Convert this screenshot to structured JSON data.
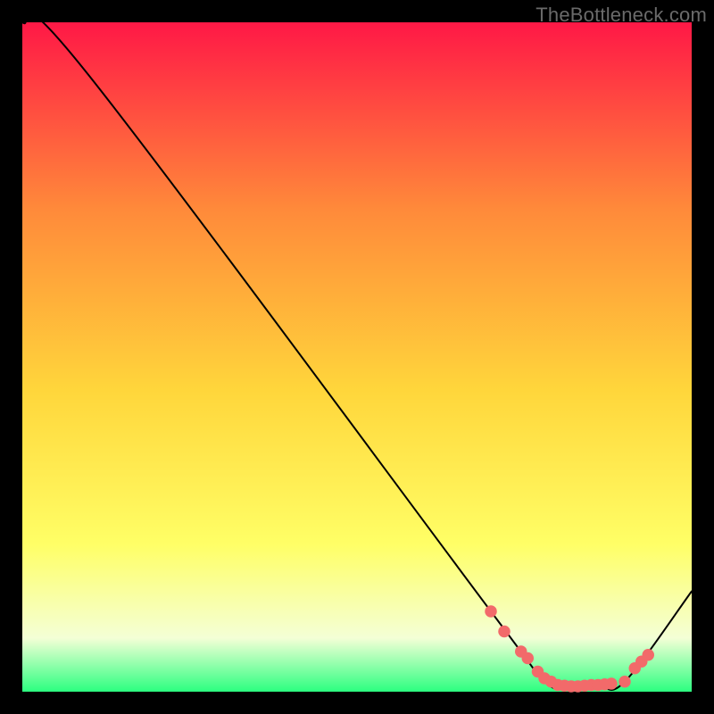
{
  "watermark": "TheBottleneck.com",
  "colors": {
    "top": "#ff1846",
    "mid_upper": "#ff8a3a",
    "mid": "#ffd63b",
    "mid_lower": "#ffff66",
    "near_bottom": "#f4ffd6",
    "bottom": "#2cff80",
    "curve": "#000000",
    "marker": "#f26a6a",
    "background": "#000000"
  },
  "chart_data": {
    "type": "line",
    "title": "",
    "xlabel": "",
    "ylabel": "",
    "xlim": [
      0,
      100
    ],
    "ylim": [
      0,
      100
    ],
    "series": [
      {
        "name": "bottleneck-curve",
        "x": [
          0,
          10,
          70,
          78,
          82,
          86,
          90,
          100
        ],
        "values": [
          100,
          92,
          12,
          1.5,
          0.8,
          1.0,
          1.5,
          15
        ]
      }
    ],
    "markers": {
      "name": "highlighted-points",
      "x": [
        70,
        72,
        74.5,
        75.5,
        77,
        78,
        79,
        80,
        81,
        82,
        83,
        84,
        85,
        86,
        87,
        88,
        90,
        91.5,
        92.5,
        93.5
      ],
      "values": [
        12,
        9,
        6,
        5,
        3,
        2,
        1.5,
        1.0,
        0.9,
        0.8,
        0.8,
        0.9,
        1.0,
        1.0,
        1.1,
        1.2,
        1.5,
        3.5,
        4.5,
        5.5
      ]
    }
  }
}
